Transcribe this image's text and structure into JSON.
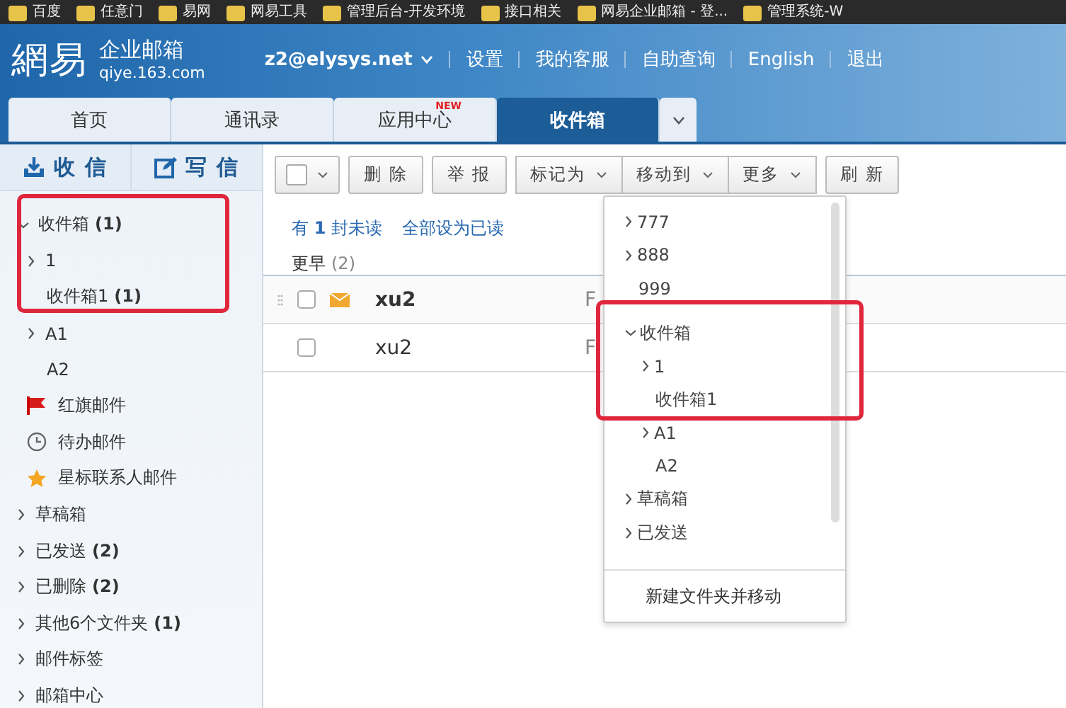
{
  "bookmarks": [
    {
      "label": "百度"
    },
    {
      "label": "任意门"
    },
    {
      "label": "易网"
    },
    {
      "label": "网易工具"
    },
    {
      "label": "管理后台-开发环境"
    },
    {
      "label": "接口相关"
    },
    {
      "label": "网易企业邮箱 - 登..."
    },
    {
      "label": "管理系统-W"
    }
  ],
  "header": {
    "brand": "網易",
    "product": "企业邮箱",
    "domain": "qiye.163.com",
    "account": "z2@elysys.net",
    "links": [
      "设置",
      "我的客服",
      "自助查询",
      "English",
      "退出"
    ]
  },
  "tabs": [
    {
      "label": "首页",
      "selected": false
    },
    {
      "label": "通讯录",
      "selected": false
    },
    {
      "label": "应用中心",
      "selected": false,
      "badge": "NEW"
    },
    {
      "label": "收件箱",
      "selected": true
    }
  ],
  "sidebar": {
    "highlight_frame": true,
    "actions": [
      {
        "kind": "receive",
        "label": "收 信"
      },
      {
        "kind": "compose",
        "label": "写 信"
      }
    ],
    "items": [
      {
        "kind": "folder",
        "label": "收件箱",
        "count": "(1)",
        "expanded": true,
        "children": [
          {
            "kind": "folder",
            "label": "1",
            "expanded": false
          },
          {
            "kind": "folder",
            "label": "收件箱1",
            "count": "(1)"
          },
          {
            "kind": "folder",
            "label": "A1",
            "expanded": false
          },
          {
            "kind": "folder",
            "label": "A2"
          }
        ]
      },
      {
        "kind": "flag",
        "label": "红旗邮件"
      },
      {
        "kind": "clock",
        "label": "待办邮件"
      },
      {
        "kind": "star",
        "label": "星标联系人邮件"
      },
      {
        "kind": "folder",
        "label": "草稿箱",
        "expanded": false
      },
      {
        "kind": "folder",
        "label": "已发送",
        "count": "(2)",
        "expanded": false
      },
      {
        "kind": "folder",
        "label": "已删除",
        "count": "(2)",
        "expanded": false
      },
      {
        "kind": "folder",
        "label": "其他6个文件夹",
        "count": "(1)",
        "expanded": false
      },
      {
        "kind": "folder",
        "label": "邮件标签",
        "expanded": false
      },
      {
        "kind": "folder",
        "label": "邮箱中心",
        "expanded": false
      }
    ]
  },
  "toolbar": [
    {
      "kind": "select"
    },
    {
      "kind": "button",
      "label": "删 除"
    },
    {
      "kind": "button",
      "label": "举 报"
    },
    {
      "kind": "menu",
      "label": "标记为"
    },
    {
      "kind": "menu",
      "label": "移动到"
    },
    {
      "kind": "menu",
      "label": "更多"
    },
    {
      "kind": "button",
      "label": "刷 新"
    }
  ],
  "summary": {
    "unread": "有 **1** 封未读",
    "mark_all": "全部设为已读"
  },
  "group": {
    "label": "更早",
    "count": "(2)"
  },
  "messages": [
    {
      "sender": "xu2",
      "unread": true,
      "preview": "F"
    },
    {
      "sender": "xu2",
      "unread": false,
      "preview": "F"
    }
  ],
  "move_menu": {
    "highlight_frame": true,
    "items": [
      {
        "label": "777",
        "expanded": false
      },
      {
        "label": "888",
        "expanded": false
      },
      {
        "label": "999"
      },
      {
        "label": "收件箱",
        "expanded": true,
        "children": [
          {
            "label": "1",
            "expanded": false
          },
          {
            "label": "收件箱1"
          },
          {
            "label": "A1",
            "expanded": false
          },
          {
            "label": "A2"
          }
        ]
      },
      {
        "label": "草稿箱",
        "expanded": false
      },
      {
        "label": "已发送",
        "expanded": false
      }
    ],
    "footer": "新建文件夹并移动"
  }
}
